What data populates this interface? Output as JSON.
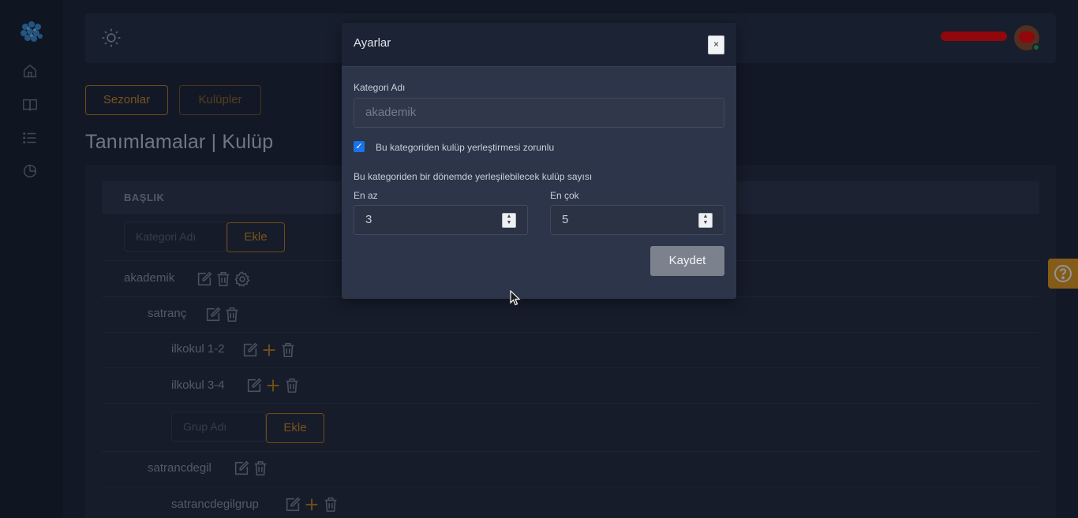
{
  "sidebar": {
    "logo": "cluster-logo",
    "items": [
      {
        "icon": "home-icon"
      },
      {
        "icon": "book-icon"
      },
      {
        "icon": "list-icon"
      },
      {
        "icon": "pie-chart-icon"
      }
    ]
  },
  "header": {
    "theme_icon": "sun-icon"
  },
  "top_buttons": {
    "seasons": "Sezonlar",
    "clubs": "Kulüpler"
  },
  "page_title": "Tanımlamalar | Kulüp",
  "table": {
    "header": "BAŞLIK",
    "category_placeholder": "Kategori Adı",
    "add_label": "Ekle",
    "group_placeholder": "Grup Adı",
    "rows": [
      {
        "label": "akademik",
        "level": 0
      },
      {
        "label": "satranç",
        "level": 1
      },
      {
        "label": "ilkokul 1-2",
        "level": 2
      },
      {
        "label": "ilkokul 3-4",
        "level": 2
      },
      {
        "label": "satrancdegil",
        "level": 1
      },
      {
        "label": "satrancdegilgrup",
        "level": 2
      }
    ]
  },
  "modal": {
    "title": "Ayarlar",
    "close": "×",
    "category_label": "Kategori Adı",
    "category_value": "akademik",
    "required_label": "Bu kategoriden kulüp yerleştirmesi zorunlu",
    "required_checked": true,
    "count_label": "Bu kategoriden bir dönemde yerleşilebilecek kulüp sayısı",
    "min_label": "En az",
    "min_value": "3",
    "max_label": "En çok",
    "max_value": "5",
    "save_label": "Kaydet"
  },
  "colors": {
    "accent": "#c27d13",
    "background": "#1a2032",
    "checkbox": "#1a73e8"
  }
}
